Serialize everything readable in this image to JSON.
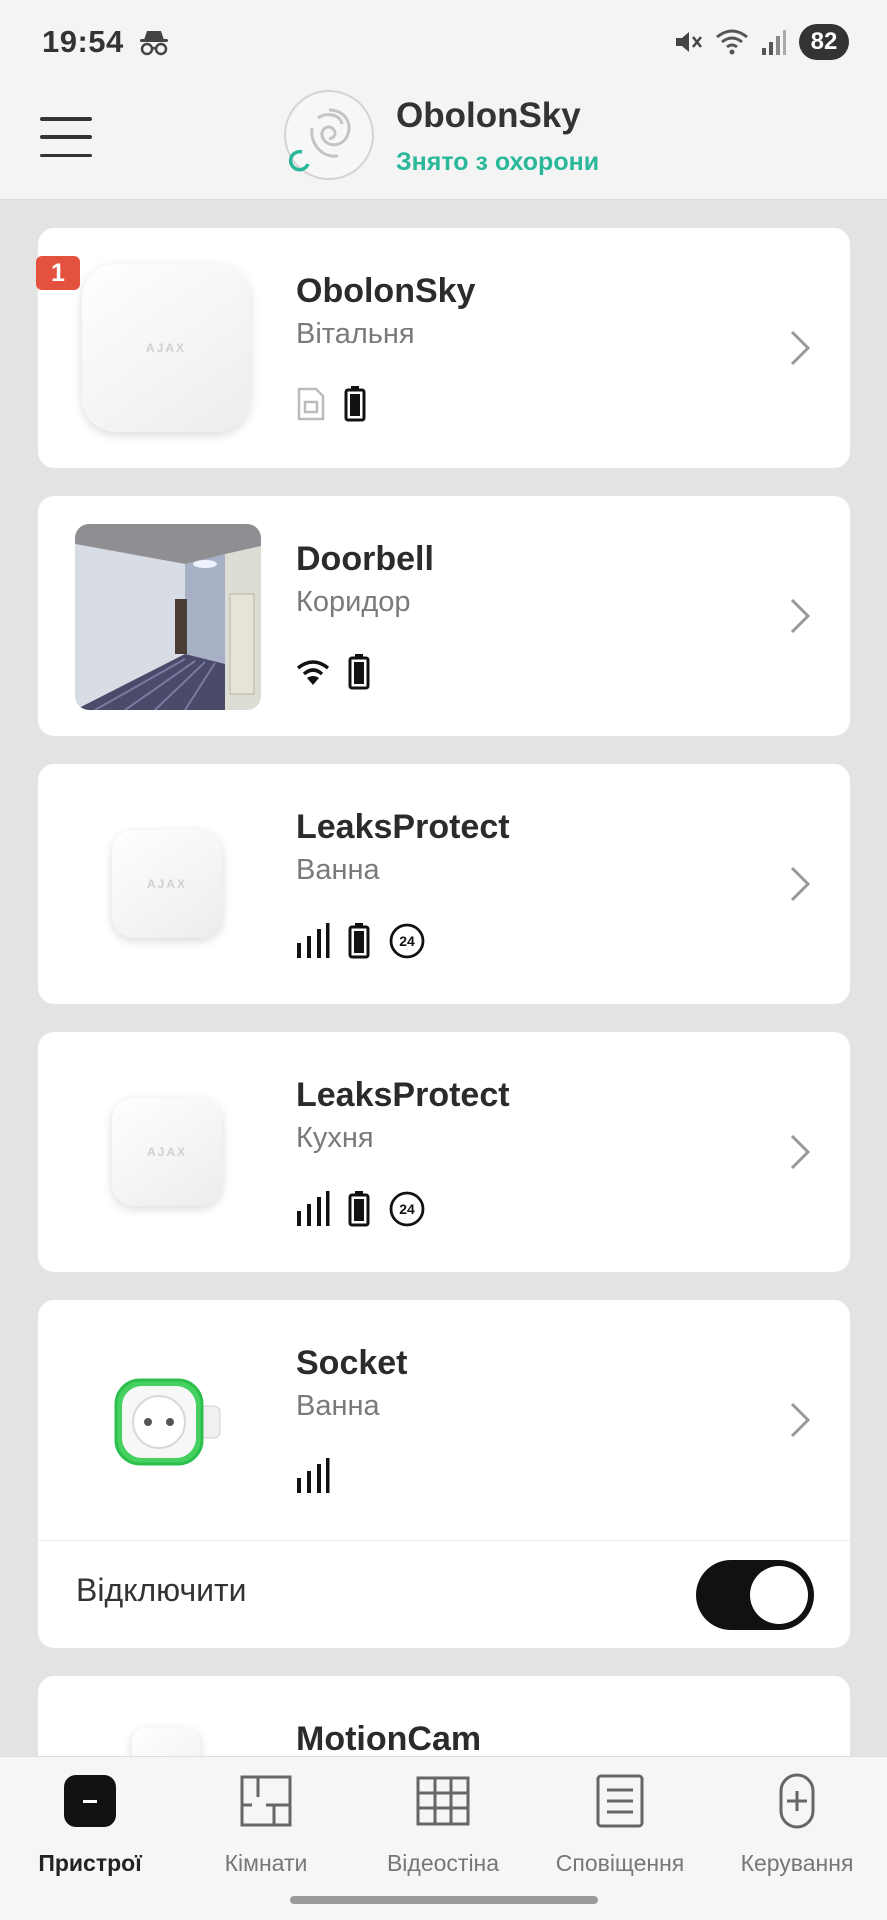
{
  "status_bar": {
    "time": "19:54",
    "battery": "82",
    "icons": [
      "incognito-icon",
      "mute-icon",
      "wifi-icon",
      "cellular-signal-icon"
    ]
  },
  "header": {
    "title": "ObolonSky",
    "status": "Знято з охорони",
    "status_color": "#2bb89a"
  },
  "devices": [
    {
      "name": "ObolonSky",
      "room": "Вітальня",
      "badge": "1",
      "icons": [
        "sim-card-icon",
        "battery-icon"
      ]
    },
    {
      "name": "Doorbell",
      "room": "Коридор",
      "icons": [
        "wifi-icon",
        "battery-icon"
      ]
    },
    {
      "name": "LeaksProtect",
      "room": "Ванна",
      "icons": [
        "signal-bars-icon",
        "battery-icon",
        "24h-icon"
      ],
      "icon_text": "24"
    },
    {
      "name": "LeaksProtect",
      "room": "Кухня",
      "icons": [
        "signal-bars-icon",
        "battery-icon",
        "24h-icon"
      ],
      "icon_text": "24"
    },
    {
      "name": "Socket",
      "room": "Ванна",
      "icons": [
        "signal-bars-icon"
      ],
      "toggle_label": "Відключити",
      "toggle_on": true
    },
    {
      "name": "MotionCam"
    }
  ],
  "device_logo_text": "AJAX",
  "bottom_nav": [
    {
      "label": "Пристрої",
      "icon": "devices-icon",
      "active": true
    },
    {
      "label": "Кімнати",
      "icon": "rooms-icon",
      "active": false
    },
    {
      "label": "Відеостіна",
      "icon": "video-wall-icon",
      "active": false
    },
    {
      "label": "Сповіщення",
      "icon": "notifications-icon",
      "active": false
    },
    {
      "label": "Керування",
      "icon": "control-icon",
      "active": false
    }
  ],
  "colors": {
    "accent": "#2bb89a",
    "badge": "#e5513f",
    "socket_glow": "#3ed15a"
  }
}
